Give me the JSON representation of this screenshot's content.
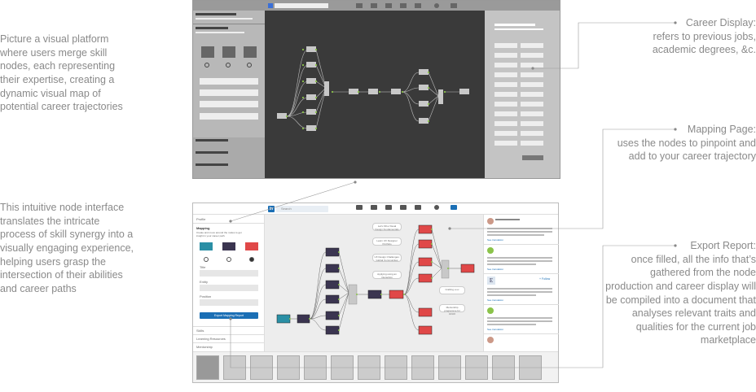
{
  "annotations": {
    "left_top": "Picture a visual platform where users merge skill nodes, each representing their expertise, creating a dynamic visual map of potential career trajectories",
    "left_bottom": "This intuitive node interface translates the intricate process of skill synergy into a visually engaging experience, helping users grasp the intersection of their abilities and career paths",
    "career_display": {
      "title": "Career Display:",
      "body": "refers to previous jobs, academic degrees, &c."
    },
    "mapping_page": {
      "title": "Mapping Page:",
      "body": "uses the nodes to pinpoint and add to your career trajectory"
    },
    "export_report": {
      "title": "Export Report:",
      "body": "once filled, all the info that’s gathered from the node production and career display will be compiled into a document that analyses relevant traits and qualities for the current job marketplace"
    }
  },
  "ui": {
    "search_placeholder": "Search",
    "nav_items": [
      "Home",
      "My Network",
      "Jobs",
      "Messaging",
      "Notifications",
      "Me",
      "Mapping"
    ],
    "left_panel": {
      "sections": [
        "Profile",
        "Mapping",
        "Skills",
        "Learning Resources",
        "Mentorship"
      ],
      "mapping_desc": "Create and move around the nodes to get insight in your career path.",
      "field_labels": [
        "Title",
        "Entity",
        "Position"
      ],
      "export_button": "Export Mapping Report"
    },
    "canvas_chips": [
      "Let's Fill a Visual Design Fundamentals",
      "Learn UX Designer Portfolio",
      "UX Design Challenges: Global Communities",
      "Applying using an interaction",
      "Crafting a ux",
      "Mentorship programme for UI/UX"
    ],
    "right_panel": {
      "follow": "+ Follow",
      "see_translation": "See translation"
    }
  },
  "colors": {
    "accent": "#1b6fb5",
    "node_red": "#e04848",
    "node_teal": "#2a8fa5",
    "node_dark": "#3b3550",
    "link": "#8bc34a"
  }
}
